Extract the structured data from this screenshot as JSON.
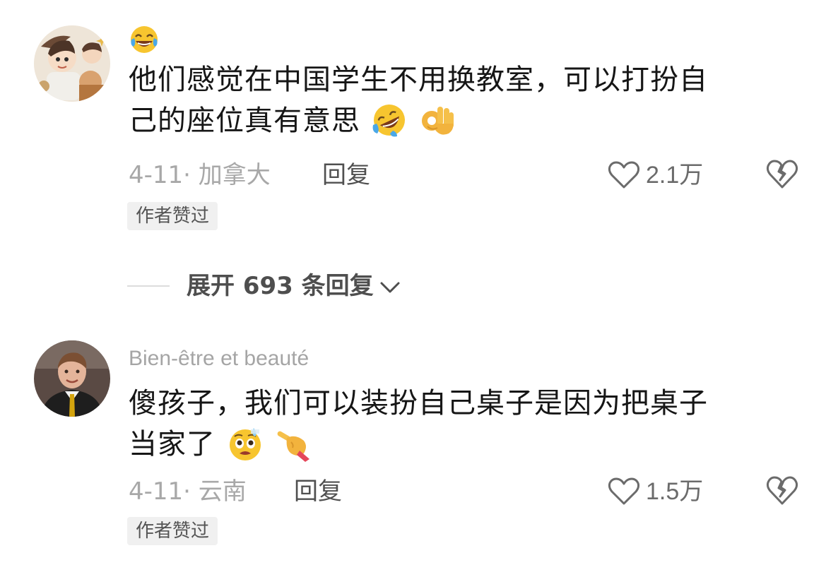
{
  "comments": [
    {
      "username": "",
      "leading_emoji": "tears-of-joy-emoji",
      "text_line1": "他们感觉在中国学生不用换教室，可以打扮自",
      "text_line2": "己的座位真有意思",
      "trailing_emojis": [
        "rolling-laughing-emoji",
        "ok-hand-emoji"
      ],
      "date": "4-11· 加拿大",
      "reply_label": "回复",
      "likes": "2.1万",
      "badge": "作者赞过",
      "avatar_icon": "anime-avatar-icon"
    },
    {
      "username": "Bien-être et beauté",
      "text_line1": "傻孩子，我们可以装扮自己桌子是因为把桌子",
      "text_line2": "当家了",
      "trailing_emojis": [
        "pleading-sweat-emoji",
        "pointing-hand-emoji"
      ],
      "date": "4-11· 云南",
      "reply_label": "回复",
      "likes": "1.5万",
      "badge": "作者赞过",
      "avatar_icon": "portrait-avatar-icon"
    }
  ],
  "expand": {
    "label": "展开 693 条回复"
  },
  "colors": {
    "muted_text": "#a8a8a8",
    "body_text": "#161616",
    "badge_bg": "#f0f0f0",
    "emoji_yellow": "#f7c52f"
  }
}
